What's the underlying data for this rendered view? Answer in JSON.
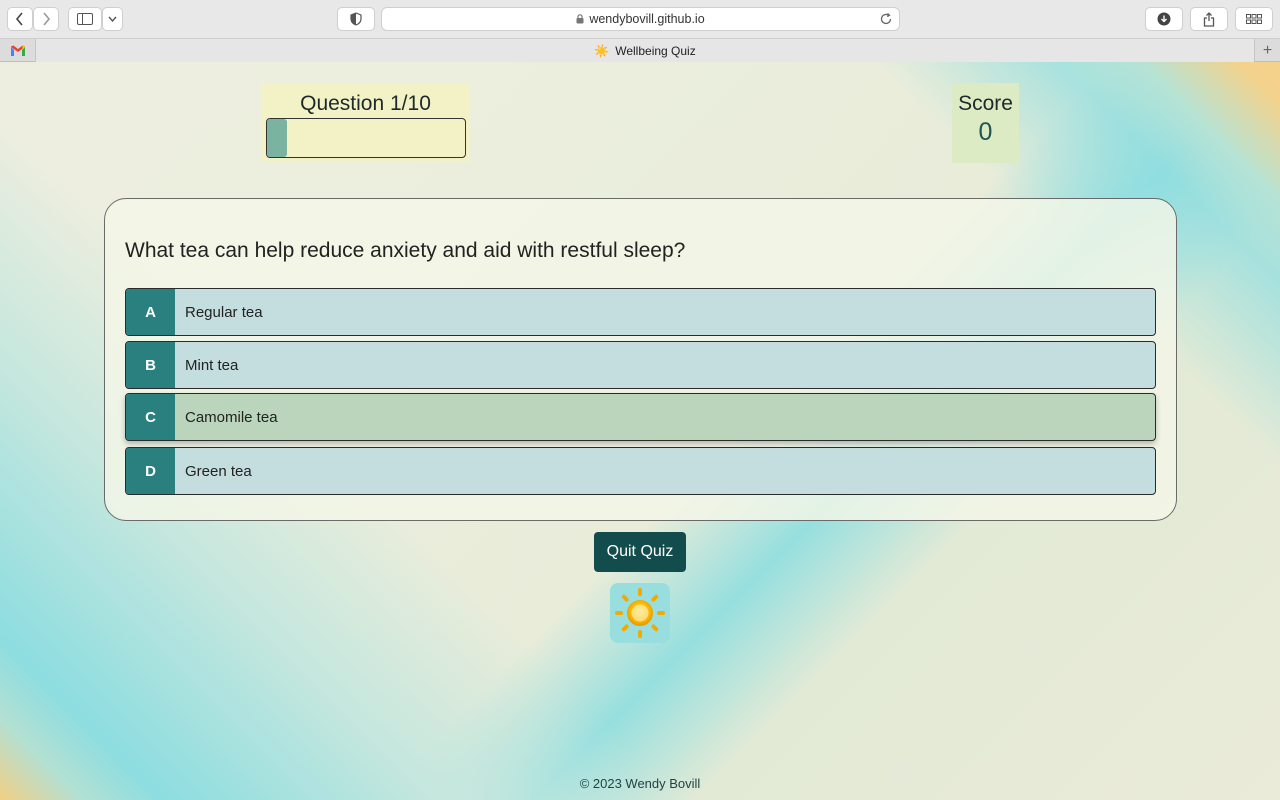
{
  "browser": {
    "url": "wendybovill.github.io",
    "tab_title": "Wellbeing Quiz",
    "tab_favicon": "☀️",
    "pinned_tab_icon": "gmail-icon"
  },
  "hud": {
    "question_label": "Question 1/10",
    "progress_fraction": 0.1,
    "score_label": "Score",
    "score_value": "0"
  },
  "quiz": {
    "question": "What tea can help reduce anxiety and aid with restful sleep?",
    "choices": [
      {
        "prefix": "A",
        "text": "Regular tea"
      },
      {
        "prefix": "B",
        "text": "Mint tea"
      },
      {
        "prefix": "C",
        "text": "Camomile tea"
      },
      {
        "prefix": "D",
        "text": "Green tea"
      }
    ],
    "hovered_choice": "C"
  },
  "quit_button": "Quit Quiz",
  "logo_icon": "sun-icon",
  "footer": "© 2023 Wendy Bovill",
  "colors": {
    "choice_prefix": "#2a7f7f",
    "choice_bg": "#c4dedf",
    "choice_hover_bg": "#bad5bc",
    "quit_bg": "#124c4c",
    "progress_fill": "#7ab3a0"
  }
}
